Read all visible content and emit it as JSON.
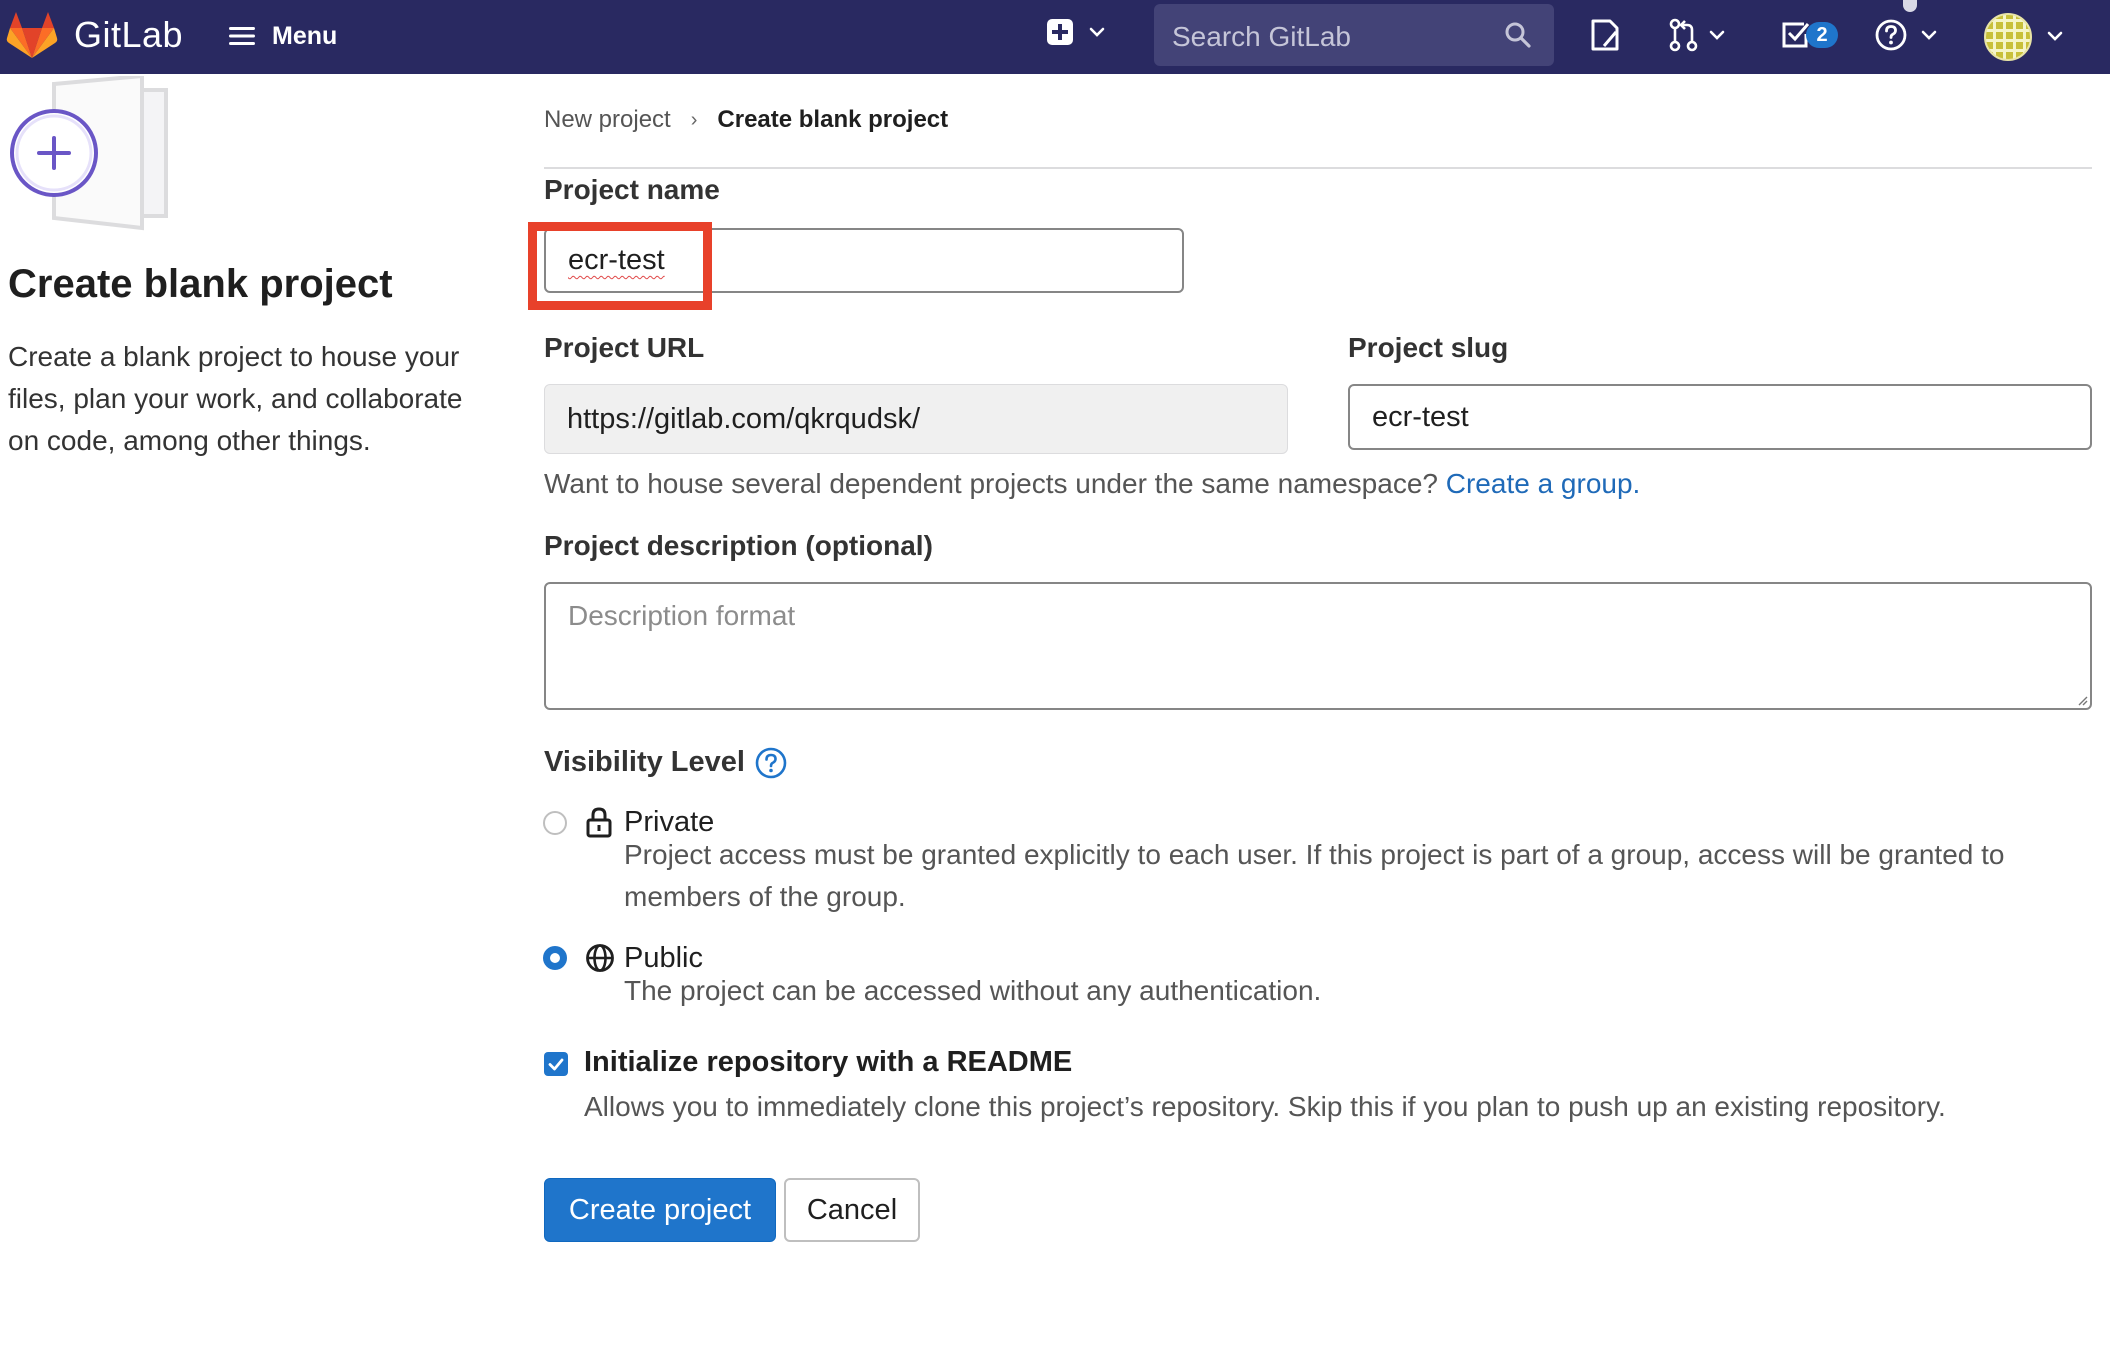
{
  "header": {
    "brand": "GitLab",
    "menu_label": "Menu",
    "search_placeholder": "Search GitLab",
    "todo_count": "2",
    "icons": [
      "gitlab-logo",
      "hamburger-icon",
      "plus-square-icon",
      "chevron-down-icon",
      "search-icon",
      "issues-icon",
      "merge-request-icon",
      "todo-icon",
      "help-icon",
      "avatar"
    ]
  },
  "sidebar": {
    "title": "Create blank project",
    "description": "Create a blank project to house your files, plan your work, and collaborate on code, among other things."
  },
  "breadcrumb": {
    "parent": "New project",
    "separator": "›",
    "current": "Create blank project"
  },
  "form": {
    "project_name_label": "Project name",
    "project_name_value": "ecr-test",
    "project_url_label": "Project URL",
    "project_url_value": "https://gitlab.com/qkrqudsk/",
    "project_slug_label": "Project slug",
    "project_slug_value": "ecr-test",
    "namespace_help": "Want to house several dependent projects under the same namespace?",
    "create_group_link": "Create a group.",
    "description_label": "Project description (optional)",
    "description_placeholder": "Description format",
    "visibility_label": "Visibility Level",
    "visibility_options": [
      {
        "title": "Private",
        "description": "Project access must be granted explicitly to each user. If this project is part of a group, access will be granted to members of the group.",
        "selected": false,
        "icon": "lock-icon"
      },
      {
        "title": "Public",
        "description": "The project can be accessed without any authentication.",
        "selected": true,
        "icon": "globe-icon"
      }
    ],
    "readme_label": "Initialize repository with a README",
    "readme_checked": true,
    "readme_help": "Allows you to immediately clone this project’s repository. Skip this if you plan to push up an existing repository.",
    "create_button": "Create project",
    "cancel_button": "Cancel"
  },
  "colors": {
    "topbar": "#292961",
    "primary": "#1f75cb",
    "highlight": "#e8412a"
  }
}
